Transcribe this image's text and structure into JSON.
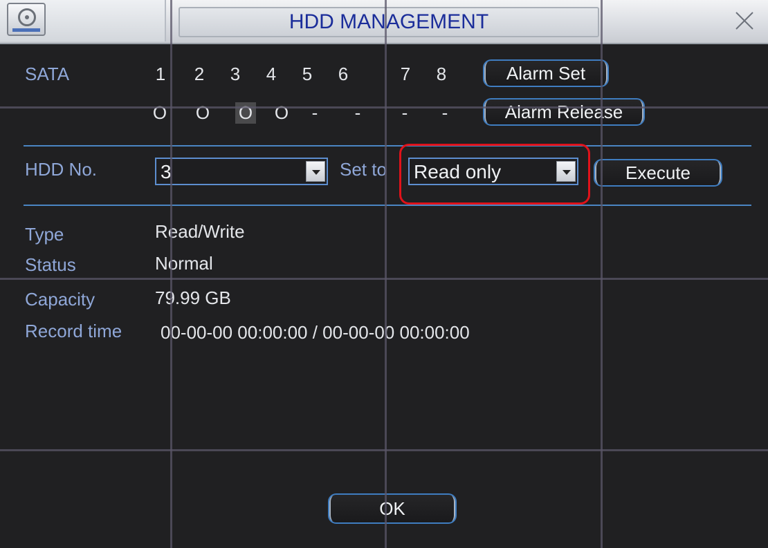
{
  "window": {
    "title": "HDD MANAGEMENT"
  },
  "sata": {
    "label": "SATA",
    "numbers": [
      "1",
      "2",
      "3",
      "4",
      "5",
      "6",
      "7",
      "8"
    ],
    "states": [
      "O",
      "O",
      "O",
      "O",
      "-",
      "-",
      "-",
      "-"
    ],
    "selected_index": 3
  },
  "buttons": {
    "alarm_set": "Alarm Set",
    "alarm_release": "Alarm Release",
    "execute": "Execute",
    "ok": "OK"
  },
  "controls": {
    "hdd_no_label": "HDD No.",
    "hdd_no_value": "3",
    "set_to_label": "Set to",
    "set_to_value": "Read only"
  },
  "info": {
    "type_label": "Type",
    "type_value": "Read/Write",
    "status_label": "Status",
    "status_value": "Normal",
    "capacity_label": "Capacity",
    "capacity_value": "79.99 GB",
    "record_time_label": "Record time",
    "record_time_value": "00-00-00 00:00:00 / 00-00-00 00:00:00"
  },
  "icons": {
    "drive": "hdd-icon",
    "close": "close-icon",
    "dropdown": "chevron-down-icon"
  },
  "colors": {
    "label": "#8fa7d8",
    "title": "#1b2d9a",
    "highlight": "#e0121a",
    "border": "#3f7dc1"
  }
}
